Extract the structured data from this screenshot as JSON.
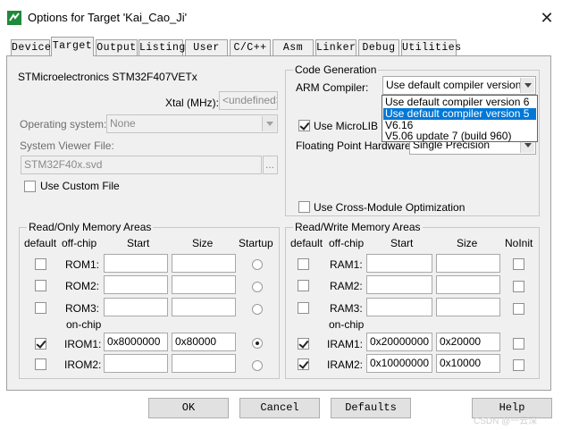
{
  "window": {
    "title": "Options for Target 'Kai_Cao_Ji'",
    "close_glyph": "✕"
  },
  "tabs": [
    {
      "label": "Device"
    },
    {
      "label": "Target"
    },
    {
      "label": "Output"
    },
    {
      "label": "Listing"
    },
    {
      "label": "User"
    },
    {
      "label": "C/C++"
    },
    {
      "label": "Asm"
    },
    {
      "label": "Linker"
    },
    {
      "label": "Debug"
    },
    {
      "label": "Utilities"
    }
  ],
  "target": {
    "device_name": "STMicroelectronics STM32F407VETx",
    "xtal_label": "Xtal (MHz):",
    "xtal_value": "<undefined>",
    "os_label": "Operating system:",
    "os_value": "None",
    "svd_label": "System Viewer File:",
    "svd_value": "STM32F40x.svd",
    "svd_browse": "...",
    "custom_file_label": "Use Custom File"
  },
  "codegen": {
    "group_title": "Code Generation",
    "compiler_label": "ARM Compiler:",
    "compiler_value": "Use default compiler version 5",
    "compiler_options": [
      "Use default compiler version 6",
      "Use default compiler version 5",
      "V6.16",
      "V5.06 update 7 (build 960)"
    ],
    "microlib_label": "Use MicroLIB",
    "fp_label": "Floating Point Hardware:",
    "fp_value": "Single Precision",
    "cross_module_label": "Use Cross-Module Optimization"
  },
  "ro_memory": {
    "group_title": "Read/Only Memory Areas",
    "headers": {
      "default": "default",
      "offchip": "off-chip",
      "start": "Start",
      "size": "Size",
      "startup": "Startup"
    },
    "onchip_label": "on-chip",
    "rows": [
      {
        "name": "ROM1:",
        "start": "",
        "size": "",
        "default": false,
        "startup": false
      },
      {
        "name": "ROM2:",
        "start": "",
        "size": "",
        "default": false,
        "startup": false
      },
      {
        "name": "ROM3:",
        "start": "",
        "size": "",
        "default": false,
        "startup": false
      },
      {
        "name": "IROM1:",
        "start": "0x8000000",
        "size": "0x80000",
        "default": true,
        "startup": true
      },
      {
        "name": "IROM2:",
        "start": "",
        "size": "",
        "default": false,
        "startup": false
      }
    ]
  },
  "rw_memory": {
    "group_title": "Read/Write Memory Areas",
    "headers": {
      "default": "default",
      "offchip": "off-chip",
      "start": "Start",
      "size": "Size",
      "noinit": "NoInit"
    },
    "onchip_label": "on-chip",
    "rows": [
      {
        "name": "RAM1:",
        "start": "",
        "size": "",
        "default": false,
        "noinit": false
      },
      {
        "name": "RAM2:",
        "start": "",
        "size": "",
        "default": false,
        "noinit": false
      },
      {
        "name": "RAM3:",
        "start": "",
        "size": "",
        "default": false,
        "noinit": false
      },
      {
        "name": "IRAM1:",
        "start": "0x20000000",
        "size": "0x20000",
        "default": true,
        "noinit": false
      },
      {
        "name": "IRAM2:",
        "start": "0x10000000",
        "size": "0x10000",
        "default": true,
        "noinit": false
      }
    ]
  },
  "buttons": {
    "ok": "OK",
    "cancel": "Cancel",
    "defaults": "Defaults",
    "help": "Help"
  },
  "watermark": "CSDN @一云深"
}
